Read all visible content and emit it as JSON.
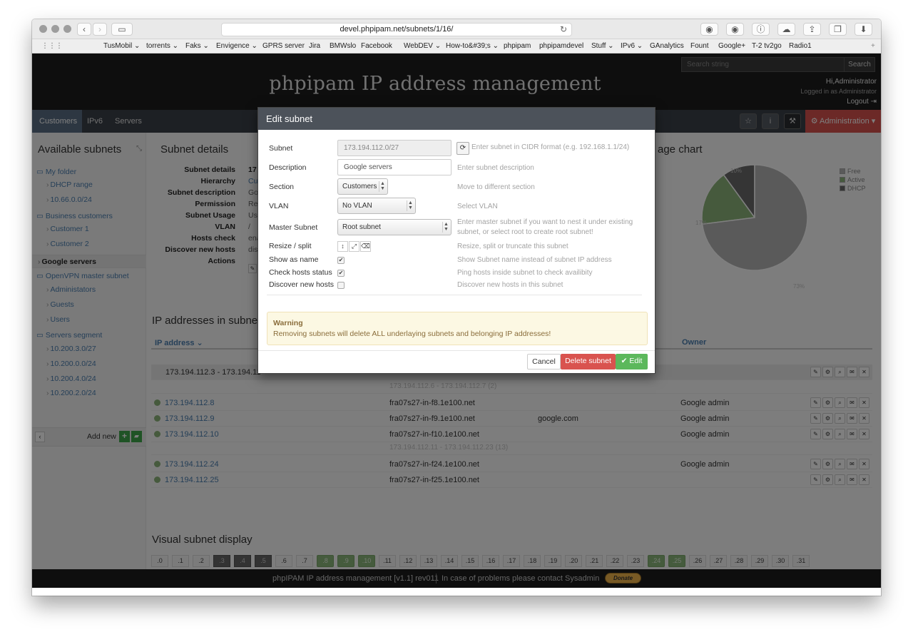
{
  "browser": {
    "url": "devel.phpipam.net/subnets/1/16/",
    "bookmarks": [
      "TusMobil ⌄",
      "torrents ⌄",
      "Faks ⌄",
      "Envigence ⌄",
      "GPRS server",
      "Jira",
      "BMWslo",
      "Facebook",
      "WebDEV ⌄",
      "How-to&#39;s ⌄",
      "phpipam",
      "phpipamdevel",
      "Stuff ⌄",
      "IPv6 ⌄",
      "GAnalytics",
      "Fount",
      "Google+",
      "T-2 tv2go",
      "Radio1"
    ]
  },
  "header": {
    "title": "phpipam IP address management",
    "search_placeholder": "Search string",
    "search_button": "Search",
    "hi": "Hi,Administrator",
    "logged_in": "Logged in as Administrator",
    "logout": "Logout"
  },
  "nav": {
    "tabs": [
      "Customers",
      "IPv6",
      "Servers"
    ],
    "admin": "Administration"
  },
  "sidebar": {
    "title": "Available subnets",
    "items": [
      {
        "label": "My folder",
        "kind": "folder"
      },
      {
        "label": "DHCP range",
        "kind": "sub"
      },
      {
        "label": "10.66.0.0/24",
        "kind": "sub"
      },
      {
        "label": "Business customers",
        "kind": "folder"
      },
      {
        "label": "Customer 1",
        "kind": "sub"
      },
      {
        "label": "Customer 2",
        "kind": "sub"
      },
      {
        "label": "Google servers",
        "kind": "selected"
      },
      {
        "label": "OpenVPN master subnet",
        "kind": "folder"
      },
      {
        "label": "Administators",
        "kind": "sub"
      },
      {
        "label": "Guests",
        "kind": "sub"
      },
      {
        "label": "Users",
        "kind": "sub"
      },
      {
        "label": "Servers segment",
        "kind": "folder"
      },
      {
        "label": "10.200.3.0/27",
        "kind": "sub"
      },
      {
        "label": "10.200.0.0/24",
        "kind": "sub"
      },
      {
        "label": "10.200.4.0/24",
        "kind": "sub"
      },
      {
        "label": "10.200.2.0/24",
        "kind": "sub"
      }
    ],
    "add_new": "Add new"
  },
  "details": {
    "title": "Subnet details",
    "labels": [
      "Subnet details",
      "Hierarchy",
      "Subnet description",
      "Permission",
      "Subnet Usage",
      "VLAN",
      "Hosts check",
      "Discover new hosts",
      "Actions"
    ],
    "values": [
      "17",
      "Cu",
      "Go",
      "Re",
      "Us",
      "/",
      "ena",
      "dis",
      ""
    ]
  },
  "usage_chart": {
    "title": "age chart",
    "legend": [
      "Free",
      "Active",
      "DHCP"
    ],
    "labels": [
      "10%",
      "17%",
      "73%"
    ],
    "colors": {
      "free": "#b5b5b5",
      "active": "#8db47a",
      "dhcp": "#6a6a6a"
    }
  },
  "chart_data": {
    "type": "pie",
    "categories": [
      "Free",
      "Active",
      "DHCP"
    ],
    "values": [
      73,
      17,
      10
    ]
  },
  "ip_table": {
    "title": "IP addresses in subnet",
    "col_ip": "IP address",
    "col_owner": "Owner",
    "range_row": "173.194.112.3 - 173.194.11",
    "rows": [
      {
        "type": "free",
        "text": "173.194.112.6 - 173.194.112.7 (2)"
      },
      {
        "type": "ip",
        "ip": "173.194.112.8",
        "host": "fra07s27-in-f8.1e100.net",
        "desc": "",
        "owner": "Google admin"
      },
      {
        "type": "ip",
        "ip": "173.194.112.9",
        "host": "fra07s27-in-f9.1e100.net",
        "desc": "google.com",
        "owner": "Google admin"
      },
      {
        "type": "ip",
        "ip": "173.194.112.10",
        "host": "fra07s27-in-f10.1e100.net",
        "desc": "",
        "owner": "Google admin"
      },
      {
        "type": "free",
        "text": "173.194.112.11 - 173.194.112.23 (13)"
      },
      {
        "type": "ip",
        "ip": "173.194.112.24",
        "host": "fra07s27-in-f24.1e100.net",
        "desc": "",
        "owner": "Google admin"
      },
      {
        "type": "ip",
        "ip": "173.194.112.25",
        "host": "fra07s27-in-f25.1e100.net",
        "desc": "",
        "owner": ""
      }
    ]
  },
  "visual": {
    "title": "Visual subnet display",
    "cells": [
      {
        "l": ".0",
        "s": "free"
      },
      {
        "l": ".1",
        "s": "free"
      },
      {
        "l": ".2",
        "s": "free"
      },
      {
        "l": ".3",
        "s": "used"
      },
      {
        "l": ".4",
        "s": "used"
      },
      {
        "l": ".5",
        "s": "used"
      },
      {
        "l": ".6",
        "s": "free"
      },
      {
        "l": ".7",
        "s": "free"
      },
      {
        "l": ".8",
        "s": "active"
      },
      {
        "l": ".9",
        "s": "active"
      },
      {
        "l": ".10",
        "s": "active"
      },
      {
        "l": ".11",
        "s": "free"
      },
      {
        "l": ".12",
        "s": "free"
      },
      {
        "l": ".13",
        "s": "free"
      },
      {
        "l": ".14",
        "s": "free"
      },
      {
        "l": ".15",
        "s": "free"
      },
      {
        "l": ".16",
        "s": "free"
      },
      {
        "l": ".17",
        "s": "free"
      },
      {
        "l": ".18",
        "s": "free"
      },
      {
        "l": ".19",
        "s": "free"
      },
      {
        "l": ".20",
        "s": "free"
      },
      {
        "l": ".21",
        "s": "free"
      },
      {
        "l": ".22",
        "s": "free"
      },
      {
        "l": ".23",
        "s": "free"
      },
      {
        "l": ".24",
        "s": "active"
      },
      {
        "l": ".25",
        "s": "active"
      },
      {
        "l": ".26",
        "s": "free"
      },
      {
        "l": ".27",
        "s": "free"
      },
      {
        "l": ".28",
        "s": "free"
      },
      {
        "l": ".29",
        "s": "free"
      },
      {
        "l": ".30",
        "s": "free"
      },
      {
        "l": ".31",
        "s": "free"
      }
    ]
  },
  "footer": {
    "text": "phpIPAM IP address management [v1.1] rev011",
    "contact": "In case of problems please contact Sysadmin",
    "donate": "Donate"
  },
  "modal": {
    "title": "Edit subnet",
    "subnet_label": "Subnet",
    "subnet_value": "173.194.112.0/27",
    "subnet_help": "Enter subnet in CIDR format (e.g. 192.168.1.1/24)",
    "desc_label": "Description",
    "desc_value": "Google servers",
    "desc_help": "Enter subnet description",
    "section_label": "Section",
    "section_value": "Customers",
    "section_help": "Move to different section",
    "vlan_label": "VLAN",
    "vlan_value": "No VLAN",
    "vlan_help": "Select VLAN",
    "master_label": "Master Subnet",
    "master_value": "Root subnet",
    "master_help": "Enter master subnet if you want to nest it under existing subnet, or select root to create root subnet!",
    "resize_label": "Resize / split",
    "resize_help": "Resize, split or truncate this subnet",
    "showname_label": "Show as name",
    "showname_checked": true,
    "showname_help": "Show Subnet name instead of subnet IP address",
    "check_label": "Check hosts status",
    "check_checked": true,
    "check_help": "Ping hosts inside subnet to check availibity",
    "discover_label": "Discover new hosts",
    "discover_checked": false,
    "discover_help": "Discover new hosts in this subnet",
    "warning_title": "Warning",
    "warning_text": "Removing subnets will delete ALL underlaying subnets and belonging IP addresses!",
    "btn_cancel": "Cancel",
    "btn_delete": "Delete subnet",
    "btn_edit": "Edit"
  }
}
